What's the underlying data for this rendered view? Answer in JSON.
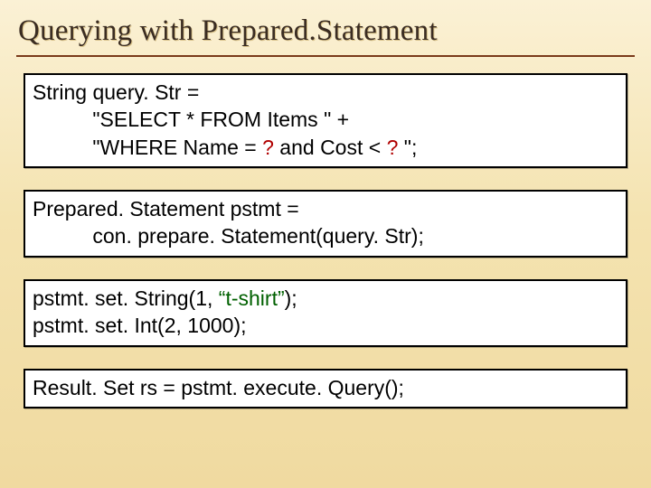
{
  "slide": {
    "title": "Querying with Prepared.Statement",
    "blocks": [
      {
        "lines": [
          {
            "plain": "String query. Str ="
          },
          {
            "indent": true,
            "plain": " \"SELECT * FROM Items \" +"
          },
          {
            "indent": true,
            "segments": [
              {
                "t": " \"WHERE Name = "
              },
              {
                "t": "?",
                "cls": "param"
              },
              {
                "t": " and Cost < "
              },
              {
                "t": "?",
                "cls": "param"
              },
              {
                "t": " \";"
              }
            ]
          }
        ]
      },
      {
        "lines": [
          {
            "plain": "Prepared. Statement pstmt ="
          },
          {
            "indent": true,
            "plain": " con. prepare. Statement(query. Str);"
          }
        ]
      },
      {
        "lines": [
          {
            "segments": [
              {
                "t": "pstmt. set. String(1, "
              },
              {
                "t": "“t-shirt”",
                "cls": "str"
              },
              {
                "t": ");"
              }
            ]
          },
          {
            "plain": "pstmt. set. Int(2, 1000);"
          }
        ]
      },
      {
        "lines": [
          {
            "plain": "Result. Set rs = pstmt. execute. Query();"
          }
        ]
      }
    ]
  }
}
